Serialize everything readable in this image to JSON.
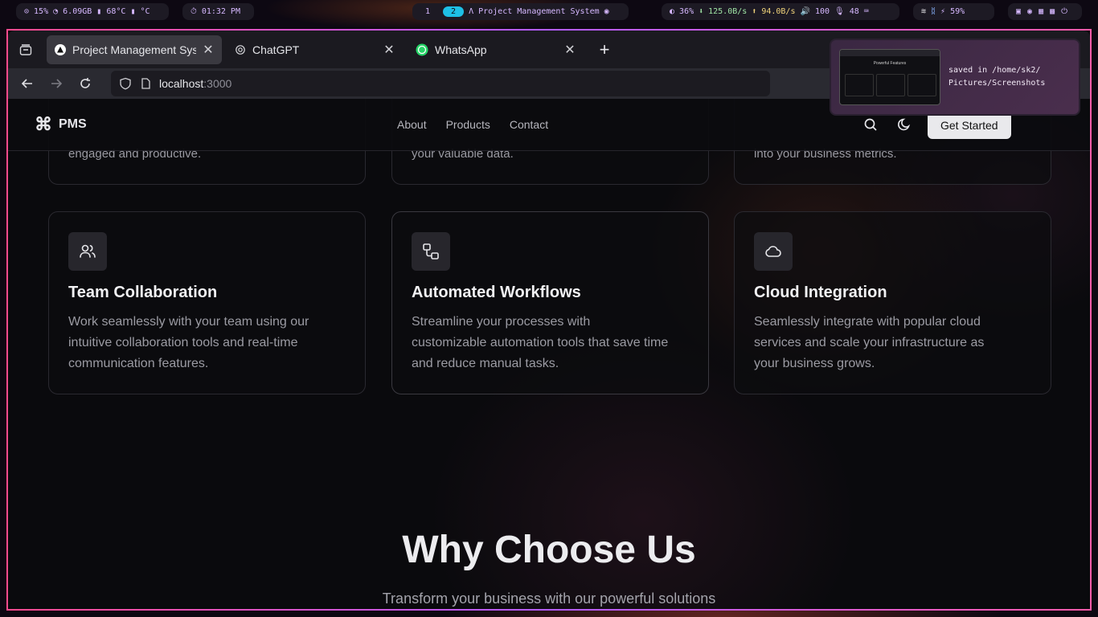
{
  "topbar": {
    "system": "⊙ 15%  ◔ 6.09GB  ▮ 68°C  ▮ °C",
    "clock": "01:32 PM",
    "workspaces": [
      "1",
      "2"
    ],
    "active_window": "Project Management System",
    "stats": {
      "brightness": "36%",
      "download": "125.0B/s",
      "upload": "94.0B/s",
      "volume": "100",
      "mic": "48"
    },
    "battery": "59%"
  },
  "browser": {
    "tabs": [
      {
        "title": "Project Management System",
        "icon": "triangle-logo-icon",
        "active": true
      },
      {
        "title": "ChatGPT",
        "icon": "chatgpt-icon",
        "active": false
      },
      {
        "title": "WhatsApp",
        "icon": "whatsapp-icon",
        "active": false
      }
    ],
    "url_host": "localhost",
    "url_port": ":3000"
  },
  "site": {
    "logo": "PMS",
    "nav": [
      "About",
      "Products",
      "Contact"
    ],
    "cta": "Get Started",
    "partial_cards": [
      "engaged and productive.",
      "your valuable data.",
      "into your business metrics."
    ],
    "features": [
      {
        "title": "Team Collaboration",
        "text": "Work seamlessly with your team using our intuitive collaboration tools and real-time communication features.",
        "icon": "users-icon"
      },
      {
        "title": "Automated Workflows",
        "text": "Streamline your processes with customizable automation tools that save time and reduce manual tasks.",
        "icon": "workflow-icon"
      },
      {
        "title": "Cloud Integration",
        "text": "Seamlessly integrate with popular cloud services and scale your infrastructure as your business grows.",
        "icon": "cloud-icon"
      }
    ],
    "why_title": "Why Choose Us",
    "why_sub": "Transform your business with our powerful solutions"
  },
  "notification": {
    "line1": "saved in /home/sk2/",
    "line2": "Pictures/Screenshots",
    "thumb_title": "Powerful Features"
  },
  "colors": {
    "accent_cyan": "#1ec0e6",
    "bar_text": "#d6b8ff",
    "window_border": "#ff4a8d"
  }
}
